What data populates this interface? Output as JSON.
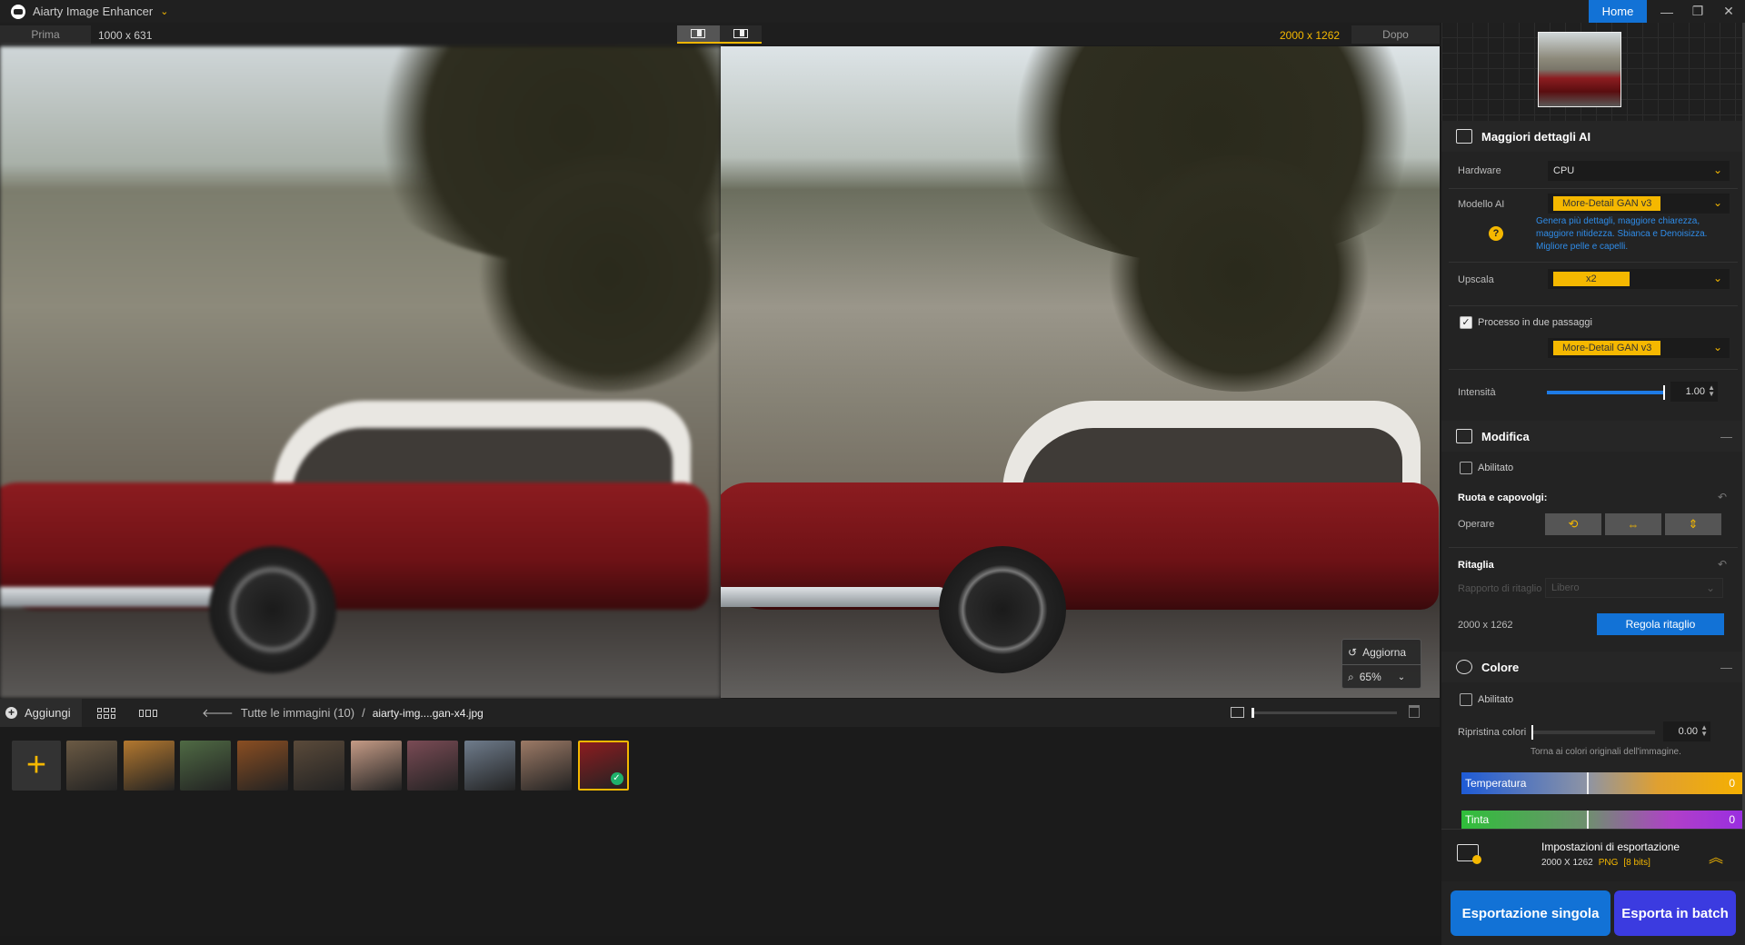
{
  "app": {
    "title": "Aiarty Image Enhancer",
    "home_label": "Home"
  },
  "window_controls": {
    "minimize": "—",
    "restore": "❐",
    "close": "✕"
  },
  "compare": {
    "before_label": "Prima",
    "before_size": "1000 x 631",
    "after_size": "2000 x 1262",
    "after_label": "Dopo",
    "refresh_label": "Aggiorna",
    "zoom_value": "65%"
  },
  "bottom": {
    "add_label": "Aggiungi",
    "breadcrumb_all": "Tutte le immagini (10)",
    "breadcrumb_sep": "/",
    "breadcrumb_file": "aiarty-img....gan-x4.jpg"
  },
  "thumbnails": [
    {
      "name": "owl",
      "color": "#6b5a44"
    },
    {
      "name": "tiger",
      "color": "#b3782f"
    },
    {
      "name": "alien",
      "color": "#4f6a44"
    },
    {
      "name": "burger",
      "color": "#8a4e22"
    },
    {
      "name": "dog-warrior",
      "color": "#5a4a3a"
    },
    {
      "name": "portrait",
      "color": "#c59b86"
    },
    {
      "name": "teddy",
      "color": "#7a4b55"
    },
    {
      "name": "street",
      "color": "#6f7c8c"
    },
    {
      "name": "kids",
      "color": "#9c7a66"
    },
    {
      "name": "red-car",
      "color": "#8c1c20",
      "selected": true
    }
  ],
  "panel": {
    "section_ai": "Maggiori dettagli AI",
    "hardware_label": "Hardware",
    "hardware_value": "CPU",
    "model_label": "Modello AI",
    "model_value": "More-Detail GAN  v3",
    "model_desc": "Genera più dettagli, maggiore chiarezza, maggiore nitidezza. Sbianca e Denoisizza. Migliore pelle e capelli.",
    "upscale_label": "Upscala",
    "upscale_value": "x2",
    "twopass_label": "Processo in due passaggi",
    "twopass_model": "More-Detail GAN  v3",
    "intensity_label": "Intensità",
    "intensity_value": "1.00",
    "intensity_fraction": 1.0,
    "section_edit": "Modifica",
    "edit_enabled_label": "Abilitato",
    "rotate_label": "Ruota e capovolgi:",
    "operate_label": "Operare",
    "crop_label": "Ritaglia",
    "crop_ratio_label": "Rapporto di ritaglio",
    "crop_ratio_value": "Libero",
    "crop_size": "2000 x 1262",
    "crop_button": "Regola ritaglio",
    "section_color": "Colore",
    "color_enabled_label": "Abilitato",
    "reset_colors_label": "Ripristina colori",
    "reset_colors_value": "0.00",
    "reset_colors_hint": "Torna ai colori originali dell'immagine.",
    "temperature_label": "Temperatura",
    "temperature_value": "0",
    "tint_label": "Tinta",
    "tint_value": "0",
    "export_title": "Impostazioni di esportazione",
    "export_size": "2000 X 1262",
    "export_format": "PNG",
    "export_bits": "[8 bits]",
    "export_single": "Esportazione singola",
    "export_batch": "Esporta in batch"
  },
  "colors": {
    "accent": "#f5b800",
    "primary": "#1272d6",
    "batch": "#3b3be0"
  }
}
